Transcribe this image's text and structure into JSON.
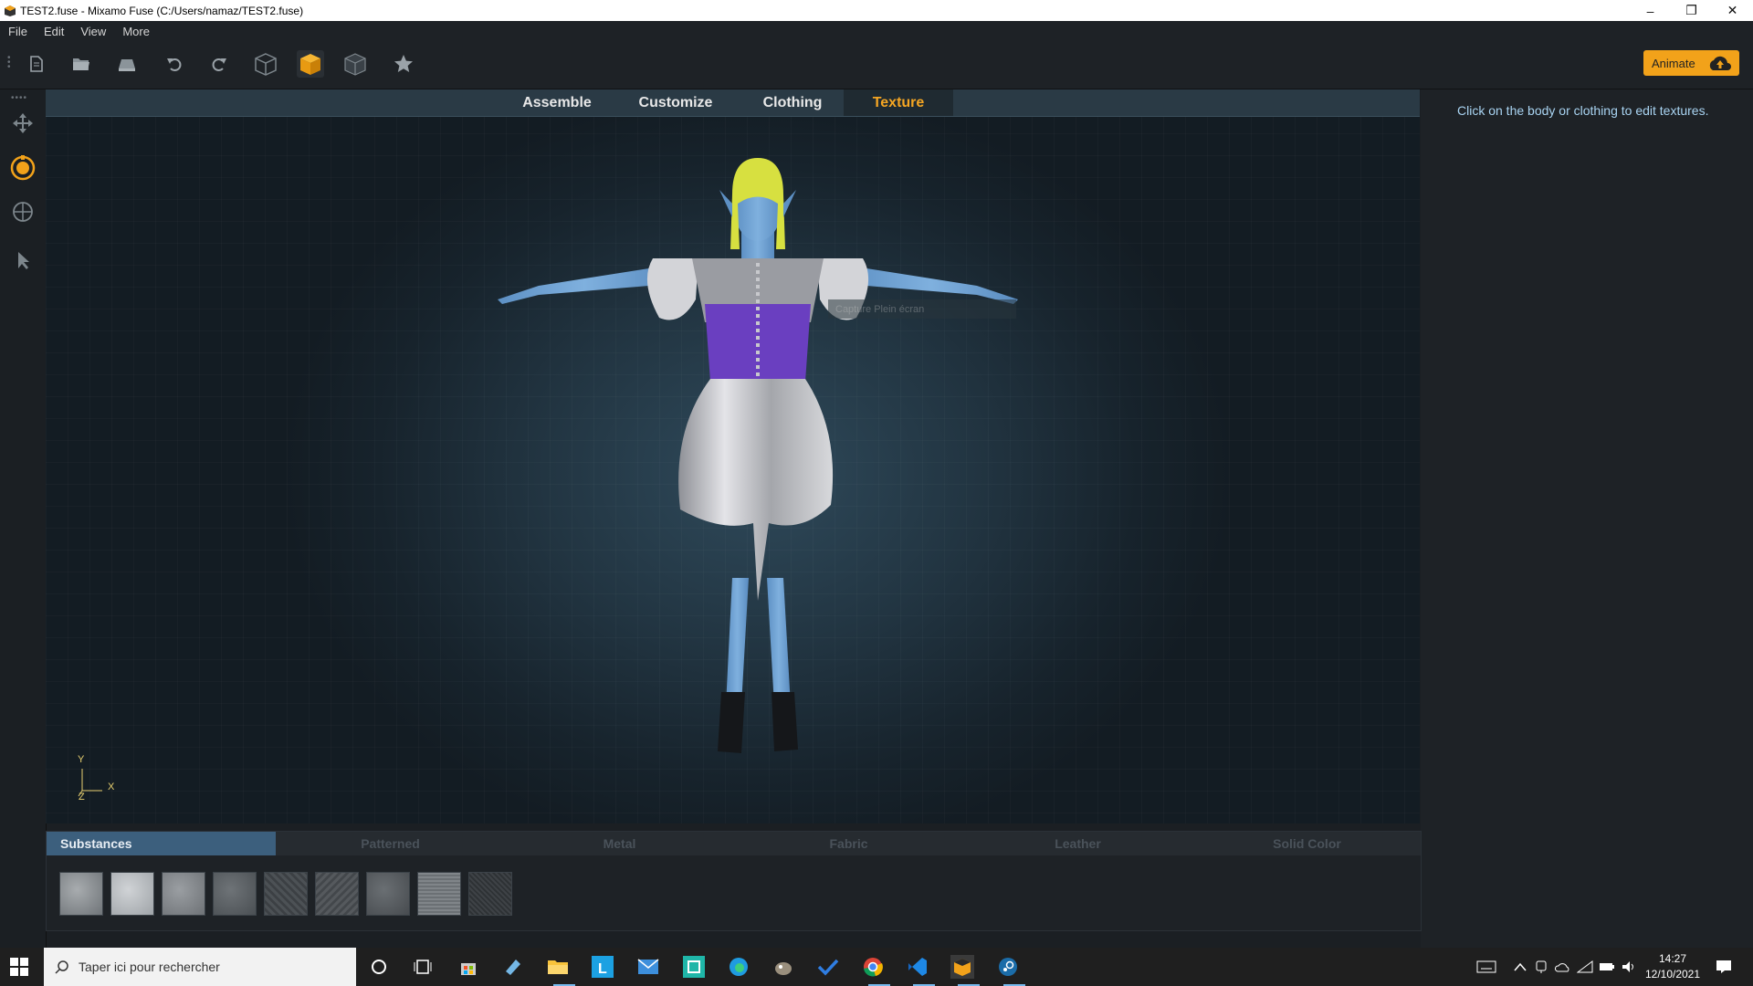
{
  "window": {
    "title": "TEST2.fuse - Mixamo Fuse (C:/Users/namaz/TEST2.fuse)",
    "minimize": "–",
    "restore": "❐",
    "close": "✕"
  },
  "menu": [
    "File",
    "Edit",
    "View",
    "More"
  ],
  "toolbar": {
    "icons": [
      "new-file-icon",
      "open-folder-icon",
      "save-icon",
      "undo-icon",
      "redo-icon",
      "wireframe-cube-icon",
      "textured-cube-icon",
      "outline-cube-icon",
      "favorite-star-icon"
    ],
    "animate_label": "Animate"
  },
  "tabs": [
    {
      "label": "Assemble",
      "active": false
    },
    {
      "label": "Customize",
      "active": false
    },
    {
      "label": "Clothing",
      "active": false
    },
    {
      "label": "Texture",
      "active": true
    }
  ],
  "viewport": {
    "tooltip": "Capture Plein écran",
    "axis": {
      "y": "Y",
      "x": "X",
      "z": "Z"
    }
  },
  "right_panel": {
    "hint": "Click on the body or clothing to edit textures."
  },
  "materials": {
    "tabs": [
      {
        "label": "Substances",
        "active": true
      },
      {
        "label": "Patterned",
        "active": false
      },
      {
        "label": "Metal",
        "active": false
      },
      {
        "label": "Fabric",
        "active": false
      },
      {
        "label": "Leather",
        "active": false
      },
      {
        "label": "Solid Color",
        "active": false
      }
    ],
    "swatch_count": 9
  },
  "taskbar": {
    "search_placeholder": "Taper ici pour rechercher",
    "time": "14:27",
    "date": "12/10/2021"
  },
  "colors": {
    "accent": "#f5a623",
    "hint_text": "#a9d4f2",
    "active_material_tab": "#3c5f7d"
  }
}
